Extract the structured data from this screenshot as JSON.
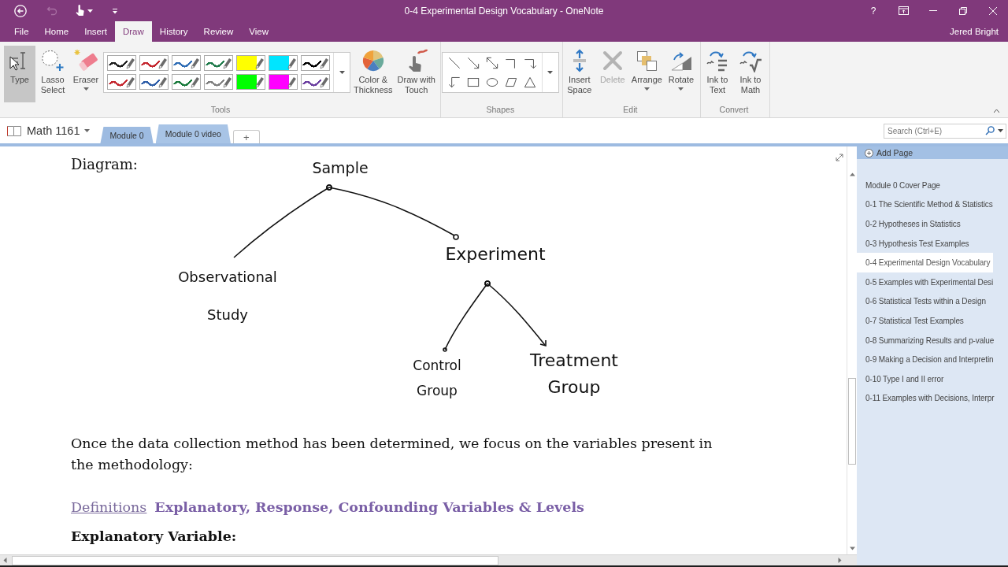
{
  "window": {
    "title": "0-4 Experimental Design Vocabulary - OneNote",
    "help": "?"
  },
  "quick_access": [
    {
      "disabled": false
    },
    {
      "disabled": true
    },
    {
      "disabled": false
    },
    {
      "disabled": false
    }
  ],
  "tabs": [
    {
      "label": "File",
      "selected": false
    },
    {
      "label": "Home",
      "selected": false
    },
    {
      "label": "Insert",
      "selected": false
    },
    {
      "label": "Draw",
      "selected": true
    },
    {
      "label": "History",
      "selected": false
    },
    {
      "label": "Review",
      "selected": false
    },
    {
      "label": "View",
      "selected": false
    }
  ],
  "account": "Jered Bright",
  "ribbon": {
    "groups": [
      {
        "label": "Tools",
        "items": [
          {
            "kind": "button",
            "label": "Type",
            "selected": true,
            "disabled": false,
            "dropdown": false
          },
          {
            "kind": "button",
            "label": "Lasso\nSelect",
            "selected": false,
            "disabled": false,
            "dropdown": false
          },
          {
            "kind": "button",
            "label": "Eraser",
            "selected": false,
            "disabled": false,
            "dropdown": true
          },
          {
            "kind": "pen-gallery",
            "pens": [
              {
                "kind": "pen",
                "color": "#1b1b1b"
              },
              {
                "kind": "pen",
                "color": "#c4262e"
              },
              {
                "kind": "pen",
                "color": "#2f6db5"
              },
              {
                "kind": "pen",
                "color": "#1e7a4a"
              },
              {
                "kind": "highlighter",
                "color": "#ffff00"
              },
              {
                "kind": "highlighter",
                "color": "#00e5ff"
              },
              {
                "kind": "pen",
                "color": "#000000"
              },
              {
                "kind": "pen",
                "color": "#c4262e"
              },
              {
                "kind": "pen",
                "color": "#2f5ea8"
              },
              {
                "kind": "pen",
                "color": "#1a7a3c"
              },
              {
                "kind": "pen",
                "color": "#7f7f7f"
              },
              {
                "kind": "highlighter",
                "color": "#00ff00"
              },
              {
                "kind": "highlighter",
                "color": "#ff00ff"
              },
              {
                "kind": "pen",
                "color": "#6b3fa0"
              }
            ]
          },
          {
            "kind": "button",
            "label": "Color &\nThickness",
            "selected": false,
            "disabled": false,
            "dropdown": false
          },
          {
            "kind": "button",
            "label": "Draw with\nTouch",
            "selected": false,
            "disabled": false,
            "dropdown": false
          }
        ]
      },
      {
        "label": "Shapes",
        "items": [
          {
            "kind": "shape-gallery"
          }
        ]
      },
      {
        "label": "Edit",
        "items": [
          {
            "kind": "button",
            "label": "Insert\nSpace",
            "selected": false,
            "disabled": false,
            "dropdown": false
          },
          {
            "kind": "button",
            "label": "Delete",
            "selected": false,
            "disabled": true,
            "dropdown": false
          },
          {
            "kind": "button",
            "label": "Arrange",
            "selected": false,
            "disabled": false,
            "dropdown": true
          },
          {
            "kind": "button",
            "label": "Rotate",
            "selected": false,
            "disabled": false,
            "dropdown": true
          }
        ]
      },
      {
        "label": "Convert",
        "items": [
          {
            "kind": "button",
            "label": "Ink to\nText",
            "selected": false,
            "disabled": false,
            "dropdown": false
          },
          {
            "kind": "button",
            "label": "Ink to\nMath",
            "selected": false,
            "disabled": false,
            "dropdown": false
          }
        ]
      }
    ]
  },
  "notebook": {
    "name": "Math 1161",
    "sections": [
      {
        "label": "Module 0",
        "selected": false
      },
      {
        "label": "Module 0 video",
        "selected": true
      }
    ],
    "add_section": "+"
  },
  "search": {
    "placeholder": "Search (Ctrl+E)"
  },
  "page": {
    "heading": "Diagram:",
    "diagram": {
      "label": "Sample",
      "children": [
        {
          "label": "Observational Study"
        },
        {
          "label": "Experiment",
          "children": [
            {
              "label": "Control Group"
            },
            {
              "label": "Treatment Group"
            }
          ]
        }
      ]
    },
    "paragraph": "Once the data collection method has been determined, we focus on the variables present in the methodology:",
    "link": "Definitions",
    "section_title": "Explanatory, Response, Confounding Variables & Levels",
    "subheading": "Explanatory Variable:"
  },
  "page_list": {
    "add_page": "Add Page",
    "pages": [
      {
        "title": "Module 0 Cover Page",
        "selected": false
      },
      {
        "title": "0-1 The Scientific Method & Statistics",
        "selected": false
      },
      {
        "title": "0-2 Hypotheses in Statistics",
        "selected": false
      },
      {
        "title": "0-3 Hypothesis Test Examples",
        "selected": false
      },
      {
        "title": "0-4 Experimental Design Vocabulary",
        "selected": true
      },
      {
        "title": "0-5 Examples with Experimental Desi",
        "selected": false
      },
      {
        "title": "0-6 Statistical Tests within a Design",
        "selected": false
      },
      {
        "title": "0-7 Statistical Test Examples",
        "selected": false
      },
      {
        "title": "0-8 Summarizing Results and p-value",
        "selected": false
      },
      {
        "title": "0-9 Making a Decision and Interpretin",
        "selected": false
      },
      {
        "title": "0-10 Type I and II error",
        "selected": false
      },
      {
        "title": "0-11 Examples with Decisions, Interpr",
        "selected": false
      }
    ]
  }
}
